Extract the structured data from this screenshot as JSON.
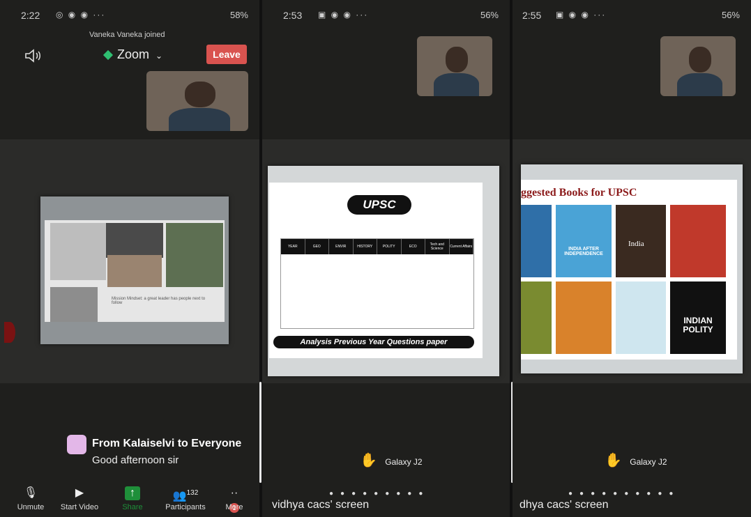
{
  "panel1": {
    "status_time": "2:22",
    "status_battery": "58%",
    "joined_notice": "Vaneka Vaneka joined",
    "meeting_label": "Zoom",
    "leave_label": "Leave",
    "slide_caption": "Mission Mindset: a great leader has people next to follow",
    "chat_title": "From Kalaiselvi to Everyone",
    "chat_message": "Good afternoon sir",
    "toolbar": {
      "unmute": "Unmute",
      "start_video": "Start Video",
      "share": "Share",
      "participants": "Participants",
      "participants_count": "132",
      "more": "More",
      "more_badge": "1"
    }
  },
  "panel2": {
    "status_time": "2:53",
    "status_battery": "56%",
    "slide_title": "UPSC",
    "table_headers": [
      "YEAR",
      "GEO",
      "ENVIR",
      "HISTORY",
      "POLITY",
      "ECO",
      "Tech and Science",
      "Current Affairs"
    ],
    "slide_footer": "Analysis Previous Year Questions paper",
    "device_label": "Galaxy J2",
    "share_label": "vidhya cacs' screen"
  },
  "panel3": {
    "status_time": "2:55",
    "status_battery": "56%",
    "slide_title": "ggested Books for UPSC",
    "book_labels": [
      "INDIA AFTER INDEPENDENCE",
      "India",
      "INDIAN POLITY"
    ],
    "device_label": "Galaxy J2",
    "share_label": "dhya cacs' screen"
  },
  "colors": {
    "leave": "#d9534f",
    "zoom_dot": "#2fbf71",
    "share_green": "#1f8f3a",
    "hand": "#f2c94c"
  }
}
